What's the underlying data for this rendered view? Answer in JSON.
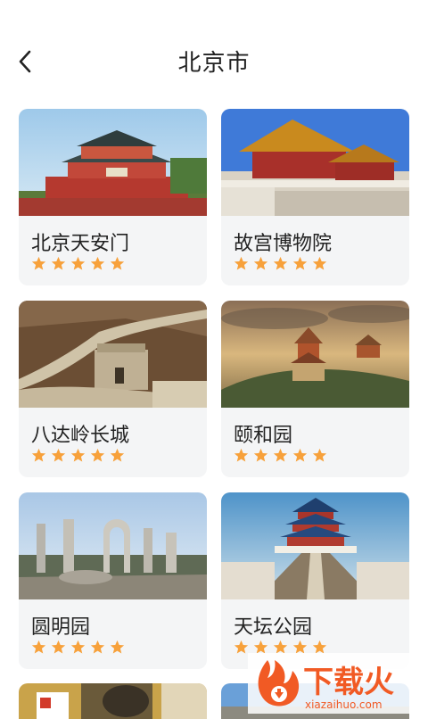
{
  "header": {
    "title": "北京市"
  },
  "cards": [
    {
      "name": "北京天安门",
      "rating": 5
    },
    {
      "name": "故宫博物院",
      "rating": 5
    },
    {
      "name": "八达岭长城",
      "rating": 5
    },
    {
      "name": "颐和园",
      "rating": 5
    },
    {
      "name": "圆明园",
      "rating": 5
    },
    {
      "name": "天坛公园",
      "rating": 5
    }
  ],
  "watermark": {
    "brand": "下载火",
    "url": "xiazaihuo.com"
  },
  "colors": {
    "star": "#F7A13B",
    "card_bg": "#F4F5F6",
    "brand_orange": "#F15A24"
  }
}
